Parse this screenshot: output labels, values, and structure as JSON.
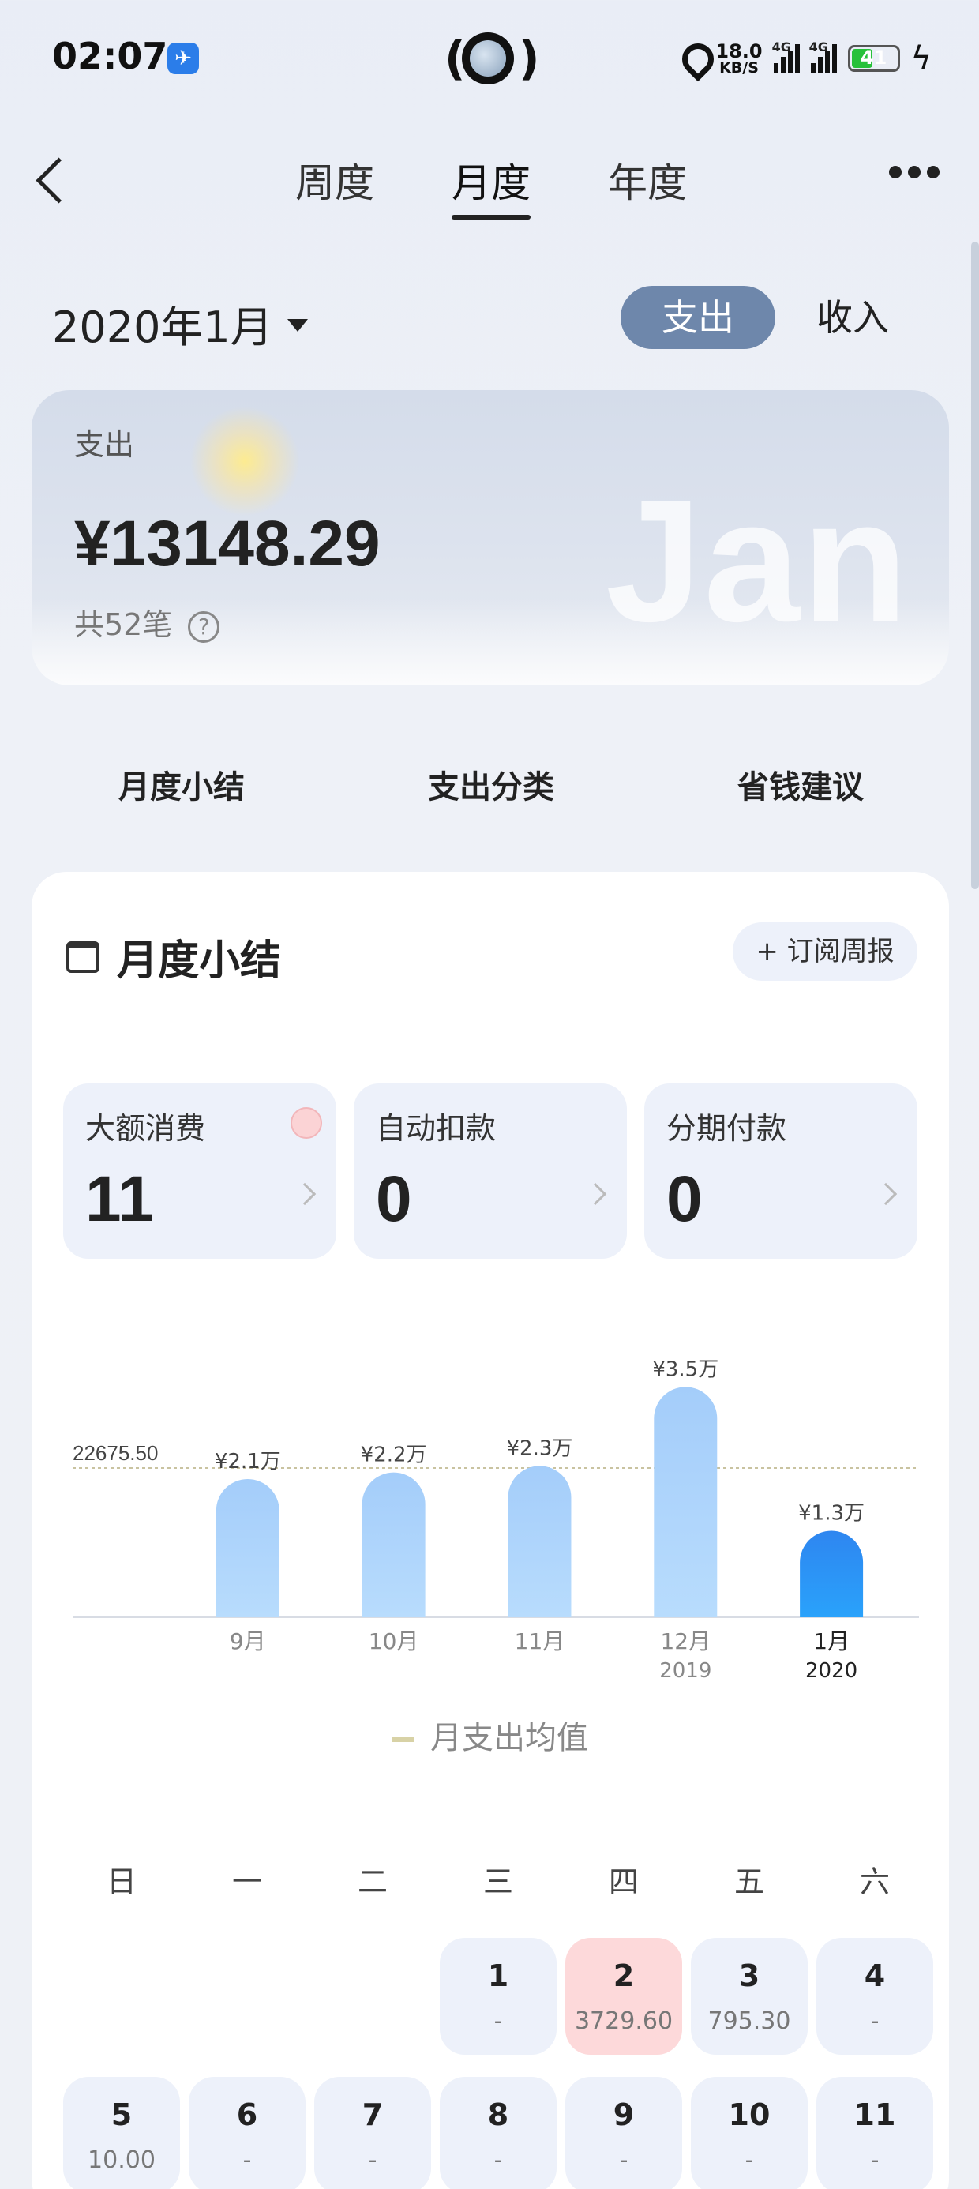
{
  "status_bar": {
    "time": "02:07",
    "net_speed": "18.0",
    "net_unit": "KB/S",
    "net_type_1": "4G",
    "net_type_2": "4G",
    "battery": "41"
  },
  "header": {
    "tabs": [
      "周度",
      "月度",
      "年度"
    ],
    "active_tab": 1
  },
  "date_selector": "2020年1月",
  "type_toggle": {
    "expense": "支出",
    "income": "收入",
    "active": "支出"
  },
  "summary_card": {
    "label": "支出",
    "amount": "¥13148.29",
    "count": "共52笔",
    "month_text": "Jan",
    "help_icon": "?"
  },
  "section_nav": [
    "月度小结",
    "支出分类",
    "省钱建议"
  ],
  "monthly_summary": {
    "title": "月度小结",
    "subscribe_label": "+ 订阅周报",
    "stats": [
      {
        "label": "大额消费",
        "value": "11"
      },
      {
        "label": "自动扣款",
        "value": "0"
      },
      {
        "label": "分期付款",
        "value": "0"
      }
    ]
  },
  "chart_data": {
    "type": "bar",
    "categories": [
      "9月",
      "10月",
      "11月",
      "12月",
      "1月"
    ],
    "category_years": [
      "",
      "",
      "",
      "2019",
      "2020"
    ],
    "values": [
      21000,
      22000,
      23000,
      35000,
      13148.29
    ],
    "value_labels": [
      "¥2.1万",
      "¥2.2万",
      "¥2.3万",
      "¥3.5万",
      "¥1.3万"
    ],
    "average_value": 22675.5,
    "average_label": "22675.50",
    "highlight_index": 4,
    "legend": "月支出均值",
    "colors": {
      "bar": "#a9d1fb",
      "bar_active": "#2a8cf5",
      "avg_line": "#c9c3a0"
    }
  },
  "calendar": {
    "weekdays": [
      "日",
      "一",
      "二",
      "三",
      "四",
      "五",
      "六"
    ],
    "days": [
      {
        "d": "1",
        "v": "-"
      },
      {
        "d": "2",
        "v": "3729.60",
        "hi": true
      },
      {
        "d": "3",
        "v": "795.30"
      },
      {
        "d": "4",
        "v": "-"
      },
      {
        "d": "5",
        "v": "10.00"
      },
      {
        "d": "6",
        "v": "-"
      },
      {
        "d": "7",
        "v": "-"
      },
      {
        "d": "8",
        "v": "-"
      },
      {
        "d": "9",
        "v": "-"
      },
      {
        "d": "10",
        "v": "-"
      },
      {
        "d": "11",
        "v": "-"
      }
    ]
  }
}
